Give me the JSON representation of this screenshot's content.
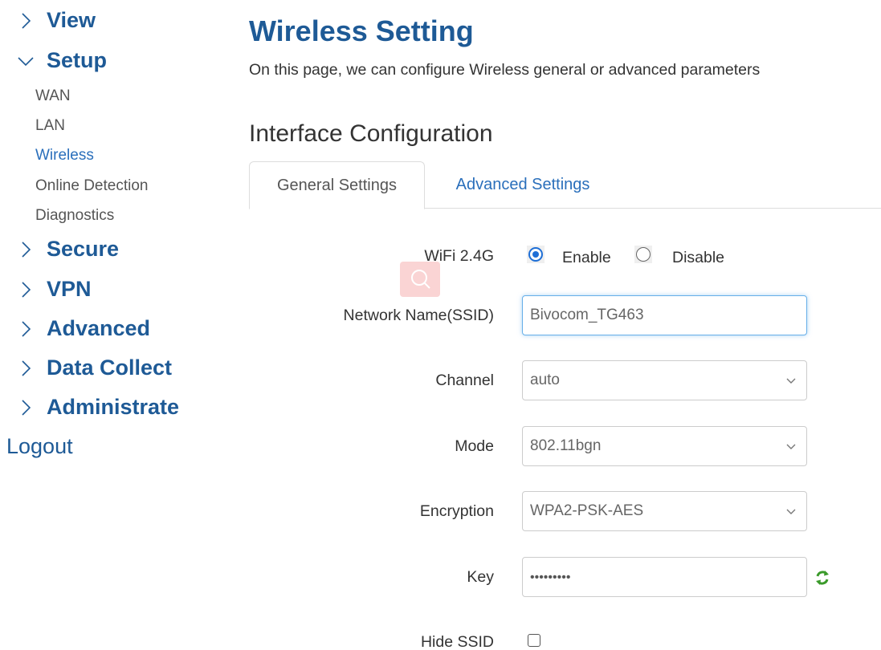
{
  "sidebar": {
    "groups": [
      {
        "label": "View",
        "expanded": false
      },
      {
        "label": "Setup",
        "expanded": true
      },
      {
        "label": "Secure",
        "expanded": false
      },
      {
        "label": "VPN",
        "expanded": false
      },
      {
        "label": "Advanced",
        "expanded": false
      },
      {
        "label": "Data Collect",
        "expanded": false
      },
      {
        "label": "Administrate",
        "expanded": false
      }
    ],
    "setup_items": [
      {
        "label": "WAN"
      },
      {
        "label": "LAN"
      },
      {
        "label": "Wireless",
        "active": true
      },
      {
        "label": "Online Detection"
      },
      {
        "label": "Diagnostics"
      }
    ],
    "logout": "Logout"
  },
  "header": {
    "title": "Wireless Setting",
    "description": "On this page, we can configure Wireless general or advanced parameters"
  },
  "section": {
    "title": "Interface Configuration"
  },
  "tabs": [
    {
      "label": "General Settings",
      "active": true
    },
    {
      "label": "Advanced Settings",
      "active": false
    }
  ],
  "form": {
    "wifi": {
      "label": "WiFi 2.4G",
      "options": [
        "Enable",
        "Disable"
      ],
      "selected": "Enable"
    },
    "ssid": {
      "label": "Network Name(SSID)",
      "value": "Bivocom_TG463"
    },
    "channel": {
      "label": "Channel",
      "value": "auto"
    },
    "mode": {
      "label": "Mode",
      "value": "802.11bgn"
    },
    "encryption": {
      "label": "Encryption",
      "value": "WPA2-PSK-AES"
    },
    "key": {
      "label": "Key",
      "masked_value": "•••••••••"
    },
    "hide_ssid": {
      "label": "Hide SSID",
      "checked": false
    }
  },
  "colors": {
    "brand_blue": "#1e5a96",
    "link_blue": "#2a6fbb",
    "radio_blue": "#1f6fd6",
    "refresh_green": "#3a9a2a"
  },
  "icons": {
    "collapsed": "chevron-right-icon",
    "expanded": "chevron-down-icon",
    "select": "chevron-down-icon",
    "key_regen": "refresh-icon",
    "overlay": "search-icon"
  }
}
